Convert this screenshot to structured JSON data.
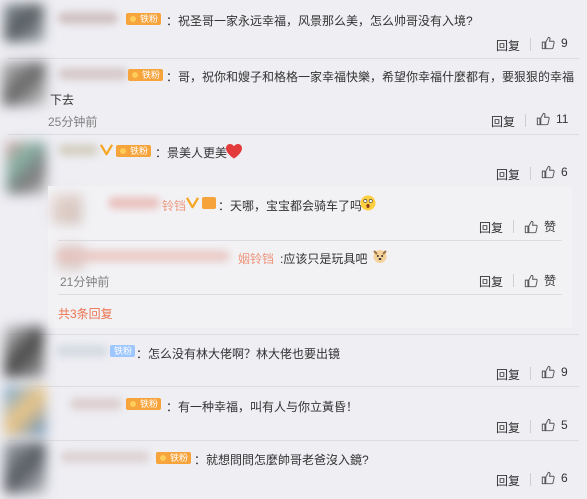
{
  "badge_label": "铁粉",
  "reply_label": "回复",
  "like_label": "赞",
  "comments": [
    {
      "text": "：祝圣哥一家永远幸福，风景那么美，怎么帅哥没有入境?",
      "likes": "9"
    },
    {
      "text_line1": "：哥，祝你和嫂子和格格一家幸福快樂，希望你幸福什麼都有，要狠狠的幸福",
      "text_line2": "下去",
      "time": "25分钟前",
      "likes": "11"
    },
    {
      "text": "：景美人更美",
      "likes": "6"
    },
    {
      "text": "：怎么没有林大佬啊？林大佬也要出镜",
      "likes": "9"
    },
    {
      "text": "：有一种幸福，叫有人与你立黃昏！",
      "likes": "5"
    },
    {
      "text": "：就想問問怎麼帥哥老爸沒入鏡?",
      "likes": "6"
    }
  ],
  "replies": [
    {
      "name_tail": "铃铛",
      "text": "：天哪，宝宝都会骑车了吗"
    },
    {
      "name_tail": "姻铃铛",
      "text": ":应该只是玩具吧",
      "time": "21分钟前"
    }
  ],
  "more_replies": "共3条回复",
  "colors": {
    "accent": "#eb7350",
    "badge": "#f7a33b",
    "background": "#eeeef3"
  }
}
